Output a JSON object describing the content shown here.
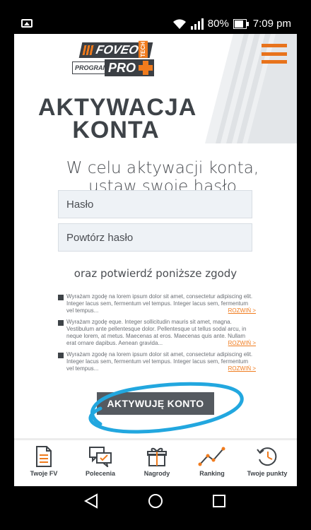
{
  "status": {
    "battery": "80%",
    "time": "7:09 pm"
  },
  "header": {
    "logo_foveo": "FOVEO",
    "logo_tech": "TECH",
    "logo_program": "PROGRAM",
    "logo_pro": "PRO",
    "title_line1": "AKTYWACJA",
    "title_line2": "KONTA"
  },
  "form": {
    "intro_line1": "W celu aktywacji konta,",
    "intro_line2": "ustaw swoje hasło",
    "password_placeholder": "Hasło",
    "repeat_placeholder": "Powtórz hasło",
    "consent_heading": "oraz potwierdź poniższe zgody",
    "consents": [
      {
        "text": "Wyrażam zgodę na lorem ipsum dolor sit amet, consectetur adipiscing elit. Integer lacus sem, fermentum vel tempus. Integer lacus sem, fermentum vel tempus...",
        "more": "ROZWIŃ >"
      },
      {
        "text": "Wyrażam zgodę eque. Integer sollicitudin mauris sit amet, magna. Vestibulum ante pellentesque dolor. Pellentesque ut tellus sodal arcu, in neque lorem, at metus. Maecenas at eros. Maecenas quis ante. Nullam erat ornare dapibus. Aenean gravida...",
        "more": "ROZWIŃ >"
      },
      {
        "text": "Wyrażam zgodę na lorem ipsum dolor sit amet, consectetur adipiscing elit. Integer lacus sem, fermentum vel tempus. Integer lacus sem, fermentum vel tempus...",
        "more": "ROZWIŃ >"
      }
    ],
    "activate_label": "AKTYWUJĘ KONTO"
  },
  "bottom_nav": [
    {
      "label": "Twoje FV",
      "icon": "document-icon"
    },
    {
      "label": "Polecenia",
      "icon": "chat-icon"
    },
    {
      "label": "Nagrody",
      "icon": "gift-icon"
    },
    {
      "label": "Ranking",
      "icon": "ranking-chart-icon"
    },
    {
      "label": "Twoje punkty",
      "icon": "history-clock-icon"
    }
  ],
  "colors": {
    "accent": "#f07b1d",
    "dark": "#3e4348",
    "annotation": "#22a7df"
  }
}
